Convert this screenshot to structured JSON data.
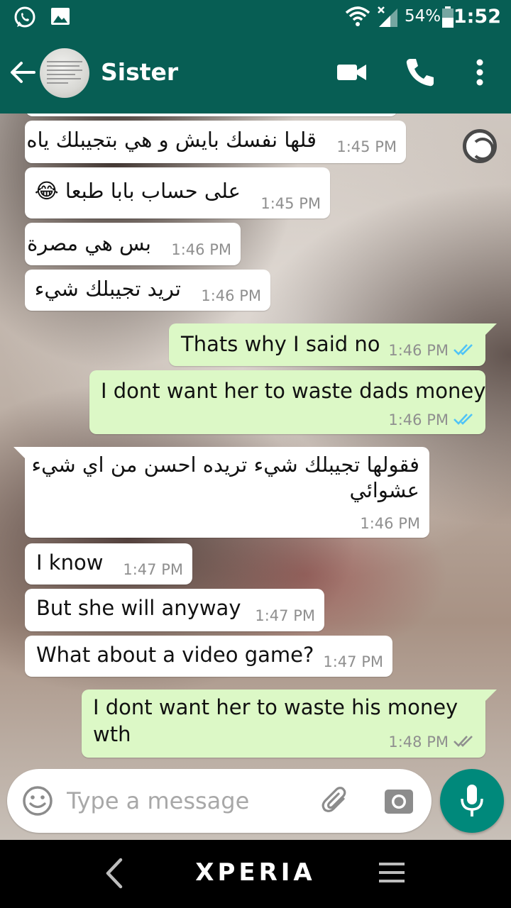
{
  "status_bar": {
    "battery": "54%",
    "time": "1:52"
  },
  "toolbar": {
    "contact_name": "Sister",
    "icons": [
      "arrow-back-icon",
      "video-call-icon",
      "phone-icon",
      "more-vert-icon"
    ]
  },
  "messages": [
    {
      "dir": "in",
      "text": "قلها نفسك بايش و هي بتجيبلك ياه",
      "time": "1:45 PM"
    },
    {
      "dir": "in",
      "text": "على حساب بابا طبعا 😂",
      "time": "1:45 PM"
    },
    {
      "dir": "in",
      "text": "بس هي مصرة",
      "time": "1:46 PM"
    },
    {
      "dir": "in",
      "text": "تريد تجيبلك شيء",
      "time": "1:46 PM"
    },
    {
      "dir": "out",
      "text": "Thats why I said no",
      "time": "1:46 PM",
      "status": "read"
    },
    {
      "dir": "out",
      "text": "I dont want her to waste dads money",
      "time": "1:46 PM",
      "status": "read"
    },
    {
      "dir": "in",
      "lines": [
        "فقولها تجيبلك شيء تريده احسن من اي شيء",
        "عشوائي"
      ],
      "time": "1:46 PM"
    },
    {
      "dir": "in",
      "text": "I know",
      "time": "1:47 PM"
    },
    {
      "dir": "in",
      "text": "But she will anyway",
      "time": "1:47 PM"
    },
    {
      "dir": "in",
      "text": "What about a video game?",
      "time": "1:47 PM"
    },
    {
      "dir": "out",
      "lines": [
        "I dont want her to waste his money",
        "wth"
      ],
      "time": "1:48 PM",
      "status": "delivered"
    }
  ],
  "input": {
    "placeholder": "Type a message"
  },
  "nav": {
    "brand": "XPERIA"
  },
  "colors": {
    "header": "#075e54",
    "outgoing_bubble": "#dcf8c6",
    "incoming_bubble": "#ffffff",
    "read_ticks": "#4fc3f7",
    "fab": "#00897b"
  }
}
